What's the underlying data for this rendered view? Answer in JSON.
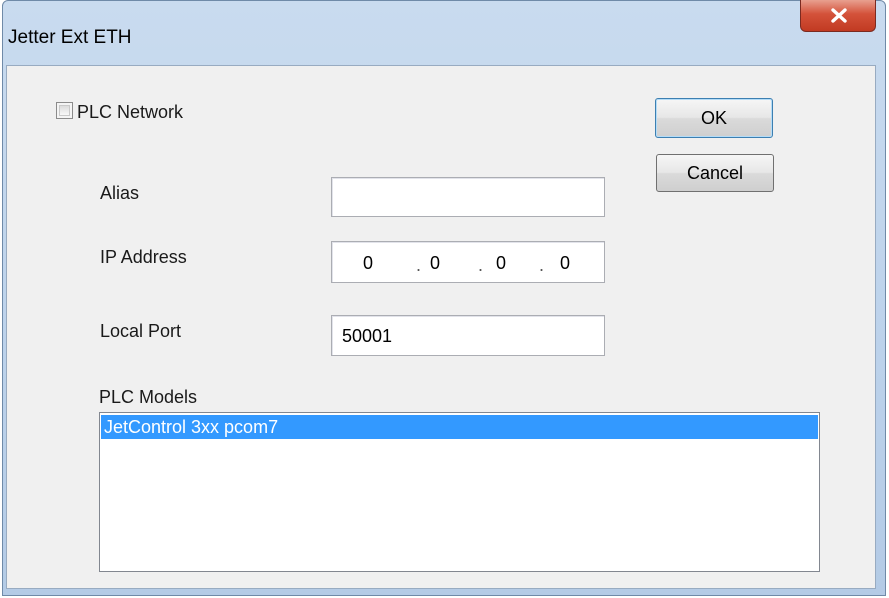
{
  "window": {
    "title": "Jetter Ext ETH"
  },
  "plc_network": {
    "label": "PLC Network",
    "checked": false
  },
  "alias": {
    "label": "Alias",
    "value": ""
  },
  "ip_address": {
    "label": "IP Address",
    "parts": [
      "0",
      "0",
      "0",
      "0"
    ]
  },
  "local_port": {
    "label": "Local Port",
    "value": "50001"
  },
  "plc_models": {
    "label": "PLC Models",
    "items": [
      "JetControl 3xx pcom7"
    ],
    "selected": "JetControl 3xx pcom7"
  },
  "buttons": {
    "ok": "OK",
    "cancel": "Cancel"
  },
  "icons": {
    "close": "close-icon"
  },
  "colors": {
    "selection": "#3399ff",
    "close_button": "#c94a32"
  }
}
